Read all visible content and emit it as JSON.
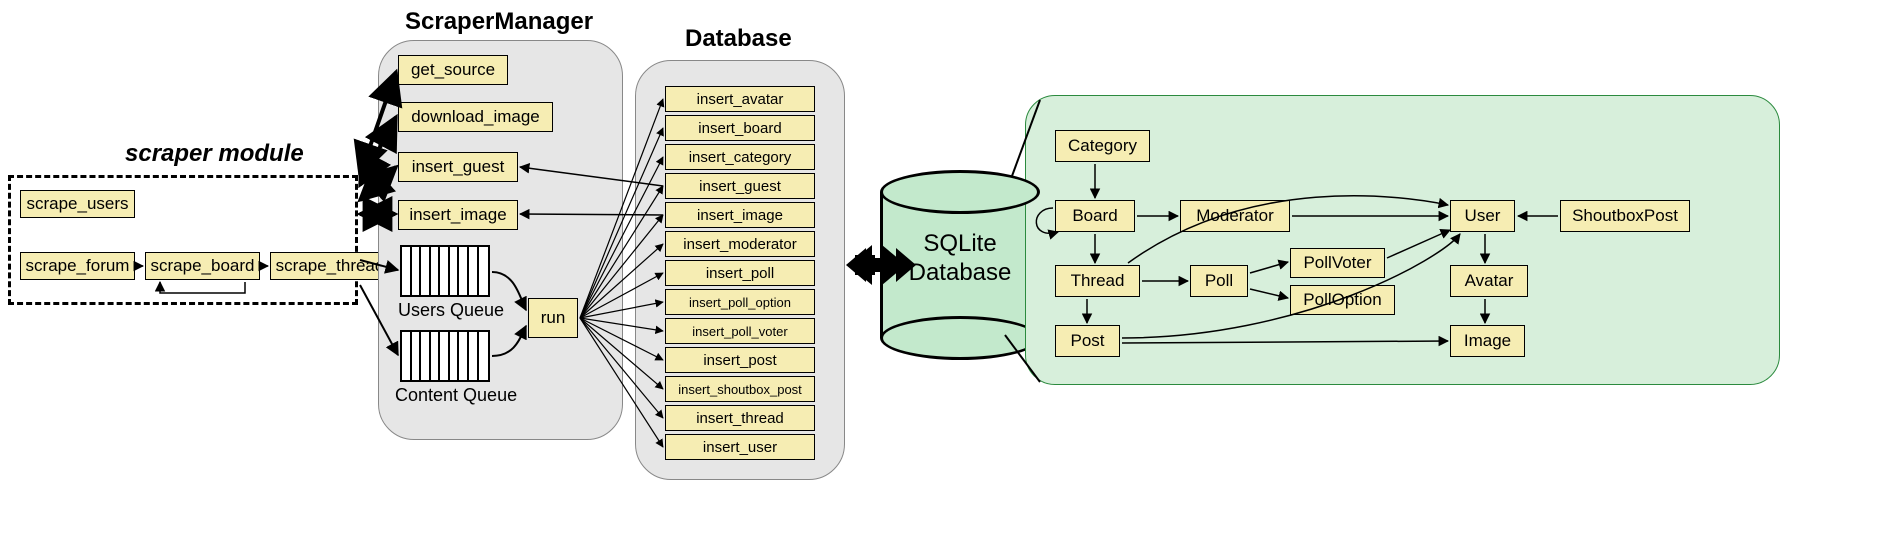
{
  "titles": {
    "scraper_module": "scraper module",
    "scraper_manager": "ScraperManager",
    "database": "Database"
  },
  "scraper_module": {
    "scrape_users": "scrape_users",
    "scrape_forum": "scrape_forum",
    "scrape_board": "scrape_board",
    "scrape_thread": "scrape_thread"
  },
  "scraper_manager": {
    "get_source": "get_source",
    "download_image": "download_image",
    "insert_guest": "insert_guest",
    "insert_image": "insert_image",
    "users_queue_label": "Users Queue",
    "content_queue_label": "Content Queue",
    "run": "run"
  },
  "database_methods": [
    "insert_avatar",
    "insert_board",
    "insert_category",
    "insert_guest",
    "insert_image",
    "insert_moderator",
    "insert_poll",
    "insert_poll_option",
    "insert_poll_voter",
    "insert_post",
    "insert_shoutbox_post",
    "insert_thread",
    "insert_user"
  ],
  "sqlite_label_1": "SQLite",
  "sqlite_label_2": "Database",
  "schema": {
    "category": "Category",
    "board": "Board",
    "moderator": "Moderator",
    "thread": "Thread",
    "poll": "Poll",
    "pollvoter": "PollVoter",
    "polloption": "PollOption",
    "post": "Post",
    "user": "User",
    "shoutboxpost": "ShoutboxPost",
    "avatar": "Avatar",
    "image": "Image"
  }
}
